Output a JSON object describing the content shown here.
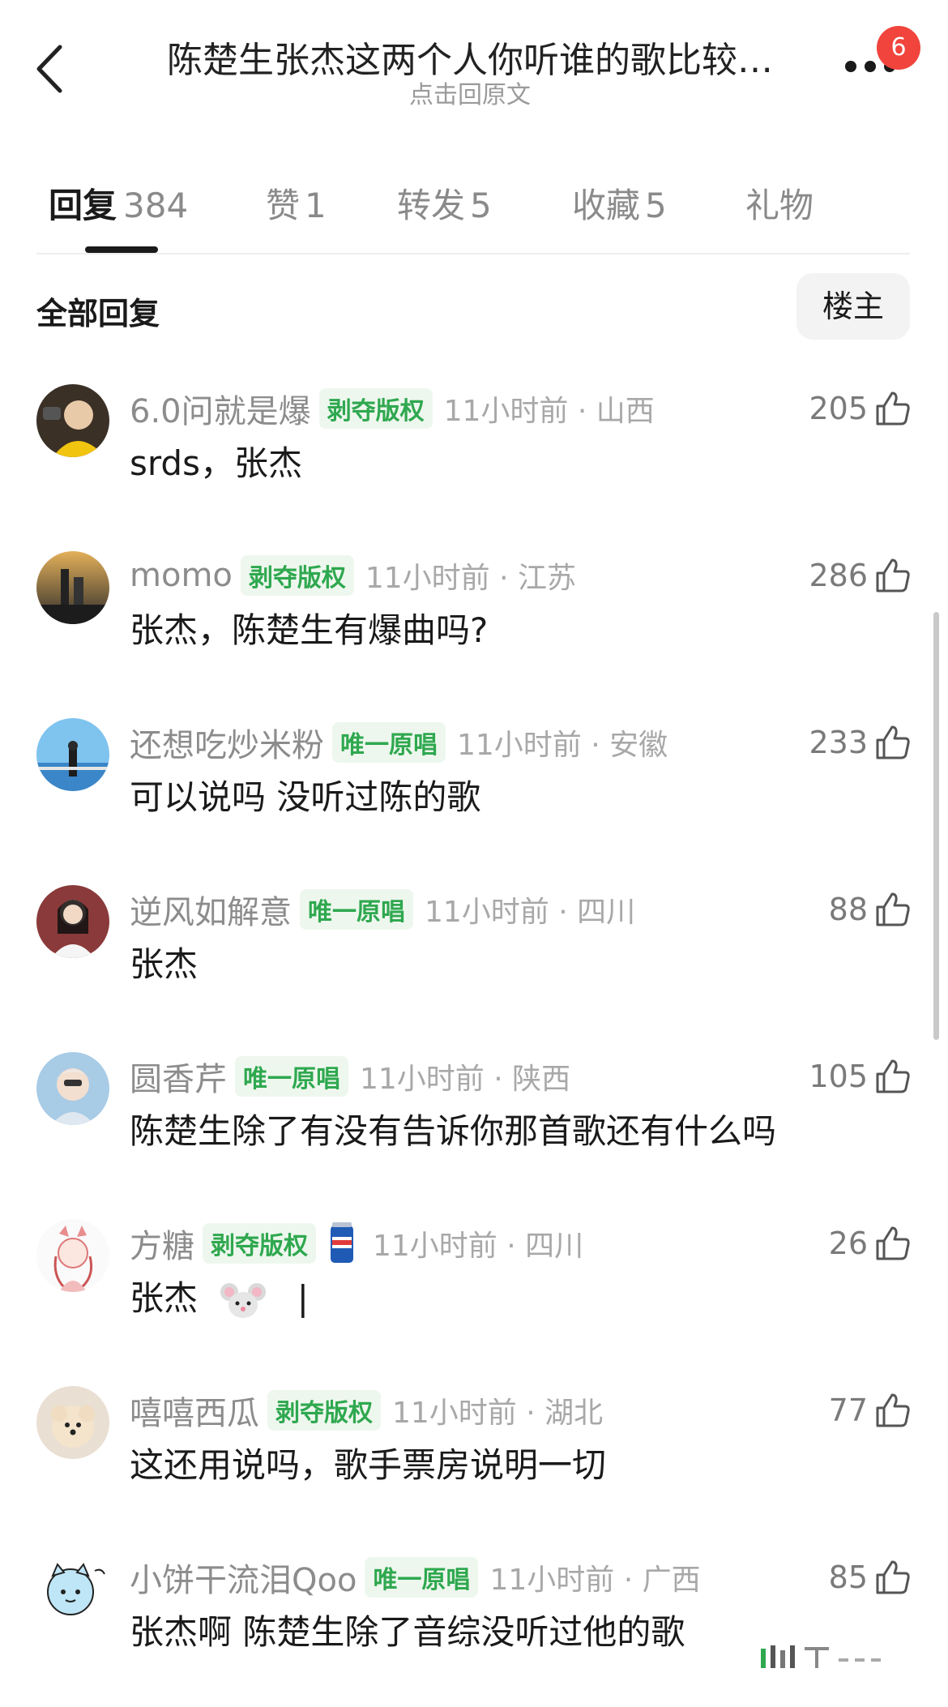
{
  "header": {
    "title": "陈楚生张杰这两个人你听谁的歌比较…",
    "subtitle": "点击回原文",
    "notification_count": "6",
    "back_icon": "chevron-left-icon",
    "more_icon": "more-dots-icon"
  },
  "tabs": [
    {
      "label": "回复",
      "count": "384",
      "active": true
    },
    {
      "label": "赞",
      "count": "1"
    },
    {
      "label": "转发",
      "count": "5"
    },
    {
      "label": "收藏",
      "count": "5"
    },
    {
      "label": "礼物",
      "count": ""
    }
  ],
  "section": {
    "title": "全部回复",
    "op_button": "楼主"
  },
  "comments": [
    {
      "user": "6.0问就是爆",
      "tag": "剥夺版权",
      "time": "11小时前 · 山西",
      "likes": "205",
      "text": "srds，张杰"
    },
    {
      "user": "momo",
      "tag": "剥夺版权",
      "time": "11小时前 · 江苏",
      "likes": "286",
      "text": "张杰，陈楚生有爆曲吗?"
    },
    {
      "user": "还想吃炒米粉",
      "tag": "唯一原唱",
      "time": "11小时前 · 安徽",
      "likes": "233",
      "text": "可以说吗 没听过陈的歌"
    },
    {
      "user": "逆风如解意",
      "tag": "唯一原唱",
      "time": "11小时前 · 四川",
      "likes": "88",
      "text": "张杰"
    },
    {
      "user": "圆香芹",
      "tag": "唯一原唱",
      "time": "11小时前 · 陕西",
      "likes": "105",
      "text": "陈楚生除了有没有告诉你那首歌还有什么吗"
    },
    {
      "user": "方糖",
      "tag": "剥夺版权",
      "time": "11小时前 · 四川",
      "likes": "26",
      "text": "张杰",
      "cursor": "|"
    },
    {
      "user": "嘻嘻西瓜",
      "tag": "剥夺版权",
      "time": "11小时前 · 湖北",
      "likes": "77",
      "text": "这还用说吗，歌手票房说明一切"
    },
    {
      "user": "小饼干流泪Qoo",
      "tag": "唯一原唱",
      "time": "11小时前 · 广西",
      "likes": "85",
      "text": "张杰啊 陈楚生除了音综没听过他的歌"
    }
  ],
  "colors": {
    "tag_green": "#2fa84f",
    "badge_red": "#f0443c"
  }
}
